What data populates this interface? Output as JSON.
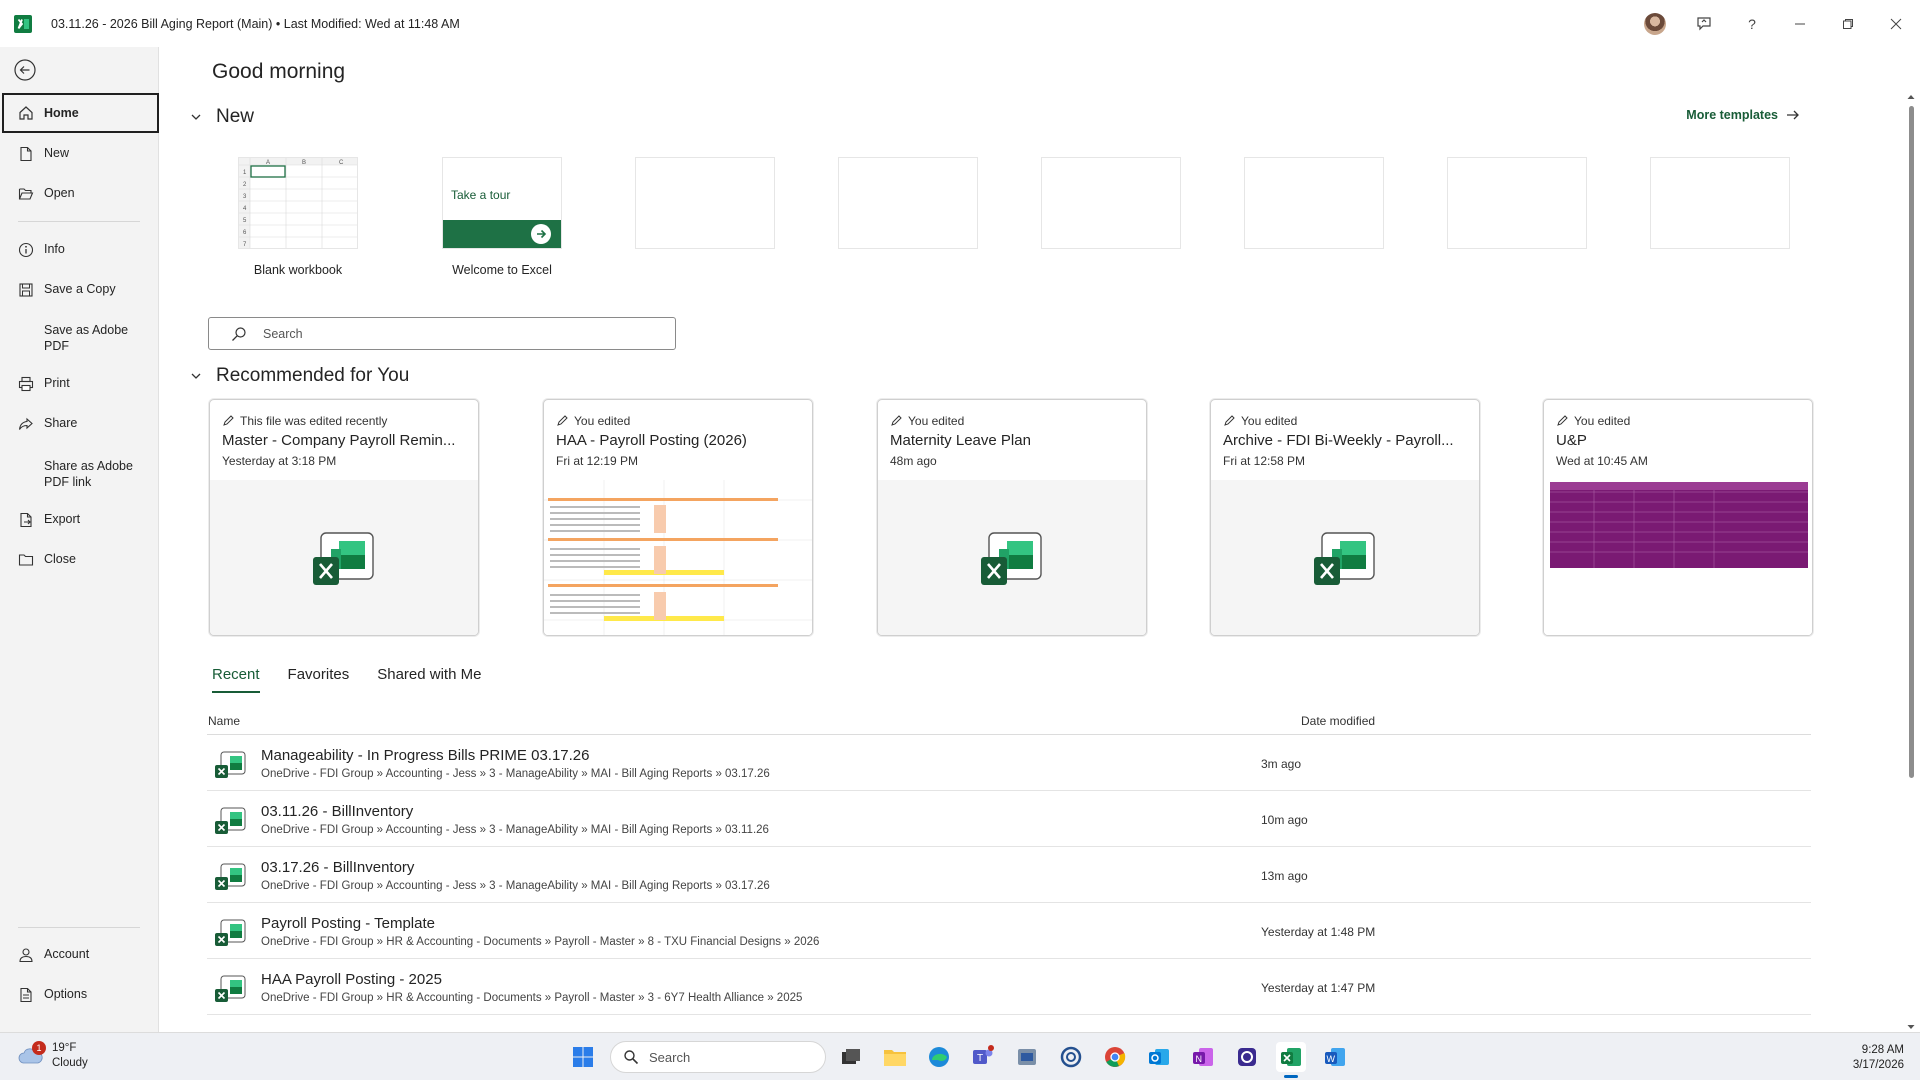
{
  "window": {
    "title": "03.11.26 - 2026 Bill Aging Report (Main)  •  Last Modified: Wed at 11:48 AM"
  },
  "sidebar": {
    "items": [
      {
        "label": "Home",
        "icon": "home-icon"
      },
      {
        "label": "New",
        "icon": "new-file-icon"
      },
      {
        "label": "Open",
        "icon": "folder-open-icon"
      },
      {
        "label": "Info",
        "icon": "info-icon"
      },
      {
        "label": "Save a Copy",
        "icon": "save-copy-icon"
      },
      {
        "label": "Save as Adobe PDF",
        "icon": ""
      },
      {
        "label": "Print",
        "icon": "print-icon"
      },
      {
        "label": "Share",
        "icon": "share-icon"
      },
      {
        "label": "Share as Adobe PDF link",
        "icon": ""
      },
      {
        "label": "Export",
        "icon": "export-icon"
      },
      {
        "label": "Close",
        "icon": "close-folder-icon"
      },
      {
        "label": "Account",
        "icon": "account-icon"
      },
      {
        "label": "Options",
        "icon": "options-icon"
      }
    ]
  },
  "main": {
    "greeting": "Good morning",
    "new_section": {
      "title": "New",
      "more_templates": "More templates",
      "templates": [
        {
          "label": "Blank workbook"
        },
        {
          "label": "Welcome to Excel",
          "tour_text": "Take a tour"
        }
      ]
    },
    "search": {
      "placeholder": "Search"
    },
    "recommended": {
      "title": "Recommended for You",
      "cards": [
        {
          "meta": "This file was edited recently",
          "name": "Master - Company Payroll Remin...",
          "time": "Yesterday at 3:18 PM",
          "preview": "excel-logo"
        },
        {
          "meta": "You edited",
          "name": "HAA - Payroll Posting (2026)",
          "time": "Fri at 12:19 PM",
          "preview": "sheet"
        },
        {
          "meta": "You edited",
          "name": "Maternity Leave Plan",
          "time": "48m ago",
          "preview": "excel-logo"
        },
        {
          "meta": "You edited",
          "name": "Archive - FDI Bi-Weekly - Payroll...",
          "time": "Fri at 12:58 PM",
          "preview": "excel-logo"
        },
        {
          "meta": "You edited",
          "name": "U&P",
          "time": "Wed at 10:45 AM",
          "preview": "purple-sheet"
        }
      ]
    },
    "tabs": [
      {
        "label": "Recent",
        "active": true
      },
      {
        "label": "Favorites",
        "active": false
      },
      {
        "label": "Shared with Me",
        "active": false
      }
    ],
    "columns": {
      "name": "Name",
      "date": "Date modified"
    },
    "files": [
      {
        "name": "Manageability - In Progress Bills PRIME 03.17.26",
        "path": "OneDrive - FDI Group » Accounting - Jess » 3 - ManageAbility » MAI - Bill Aging Reports » 03.17.26",
        "date": "3m ago"
      },
      {
        "name": "03.11.26 - BillInventory",
        "path": "OneDrive - FDI Group » Accounting - Jess » 3 - ManageAbility » MAI - Bill Aging Reports » 03.11.26",
        "date": "10m ago"
      },
      {
        "name": "03.17.26 - BillInventory",
        "path": "OneDrive - FDI Group » Accounting - Jess » 3 - ManageAbility » MAI - Bill Aging Reports » 03.17.26",
        "date": "13m ago"
      },
      {
        "name": "Payroll Posting - Template",
        "path": "OneDrive - FDI Group » HR & Accounting - Documents » Payroll - Master » 8 - TXU Financial Designs » 2026",
        "date": "Yesterday at 1:48 PM"
      },
      {
        "name": "HAA Payroll Posting - 2025",
        "path": "OneDrive - FDI Group » HR & Accounting - Documents » Payroll - Master » 3 - 6Y7 Health Alliance » 2025",
        "date": "Yesterday at 1:47 PM"
      }
    ]
  },
  "taskbar": {
    "weather": {
      "temp": "19°F",
      "condition": "Cloudy",
      "badge": "1"
    },
    "search_label": "Search",
    "time": "9:28 AM",
    "date": "3/17/2026"
  },
  "colors": {
    "excel_green": "#185c37",
    "excel_light": "#21a366",
    "accent_blue": "#0067c0"
  }
}
